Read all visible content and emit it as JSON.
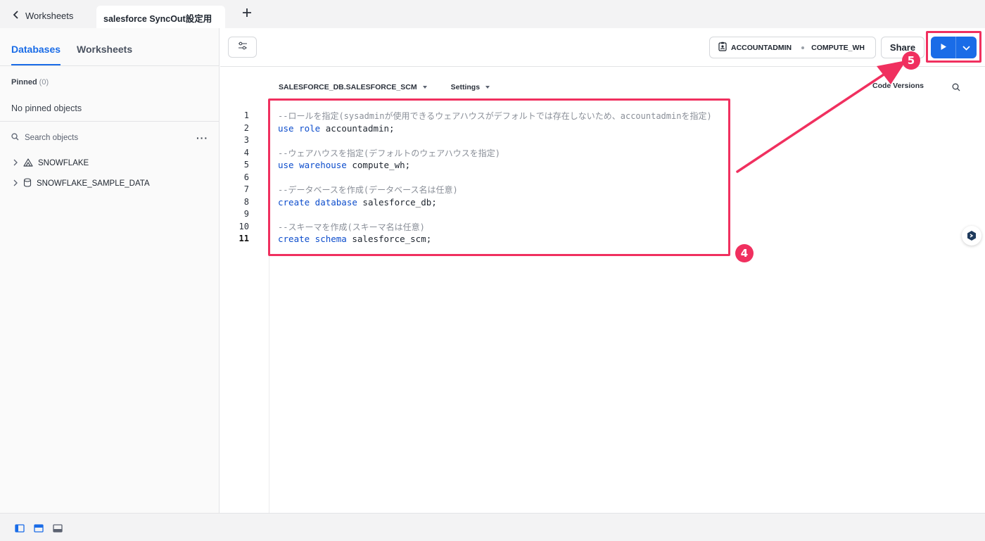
{
  "tabs": {
    "back_label": "Worksheets",
    "active_label": "salesforce SyncOut設定用"
  },
  "sidebar": {
    "tab_databases": "Databases",
    "tab_worksheets": "Worksheets",
    "pinned_label": "Pinned",
    "pinned_count": "(0)",
    "no_pinned": "No pinned objects",
    "search_placeholder": "Search objects",
    "tree": [
      {
        "label": "SNOWFLAKE",
        "icon": "snowflake-app-icon"
      },
      {
        "label": "SNOWFLAKE_SAMPLE_DATA",
        "icon": "database-icon"
      }
    ]
  },
  "toolbar": {
    "role": "ACCOUNTADMIN",
    "warehouse": "COMPUTE_WH",
    "share_label": "Share"
  },
  "context": {
    "database_schema": "SALESFORCE_DB.SALESFORCE_SCM",
    "settings_label": "Settings",
    "code_versions_label": "Code Versions"
  },
  "editor": {
    "current_line": 11,
    "lines": [
      {
        "n": "1",
        "comment": "--ロールを指定(sysadminが使用できるウェアハウスがデフォルトでは存在しないため、accountadminを指定)"
      },
      {
        "n": "2",
        "kw": "use role",
        "rest": " accountadmin;"
      },
      {
        "n": "3"
      },
      {
        "n": "4",
        "comment": "--ウェアハウスを指定(デフォルトのウェアハウスを指定)"
      },
      {
        "n": "5",
        "kw": "use warehouse",
        "rest": " compute_wh;"
      },
      {
        "n": "6"
      },
      {
        "n": "7",
        "comment": "--データベースを作成(データベース名は任意)"
      },
      {
        "n": "8",
        "kw": "create database",
        "rest": " salesforce_db;"
      },
      {
        "n": "9"
      },
      {
        "n": "10",
        "comment": "--スキーマを作成(スキーマ名は任意)"
      },
      {
        "n": "11",
        "kw": "create schema",
        "rest": " salesforce_scm;"
      }
    ]
  },
  "annotations": {
    "badge_code": "4",
    "badge_run": "5",
    "color": "#f0305f"
  },
  "colors": {
    "accent": "#1a6ce7",
    "keyword": "#0d4dcc",
    "comment": "#8a8f98"
  }
}
